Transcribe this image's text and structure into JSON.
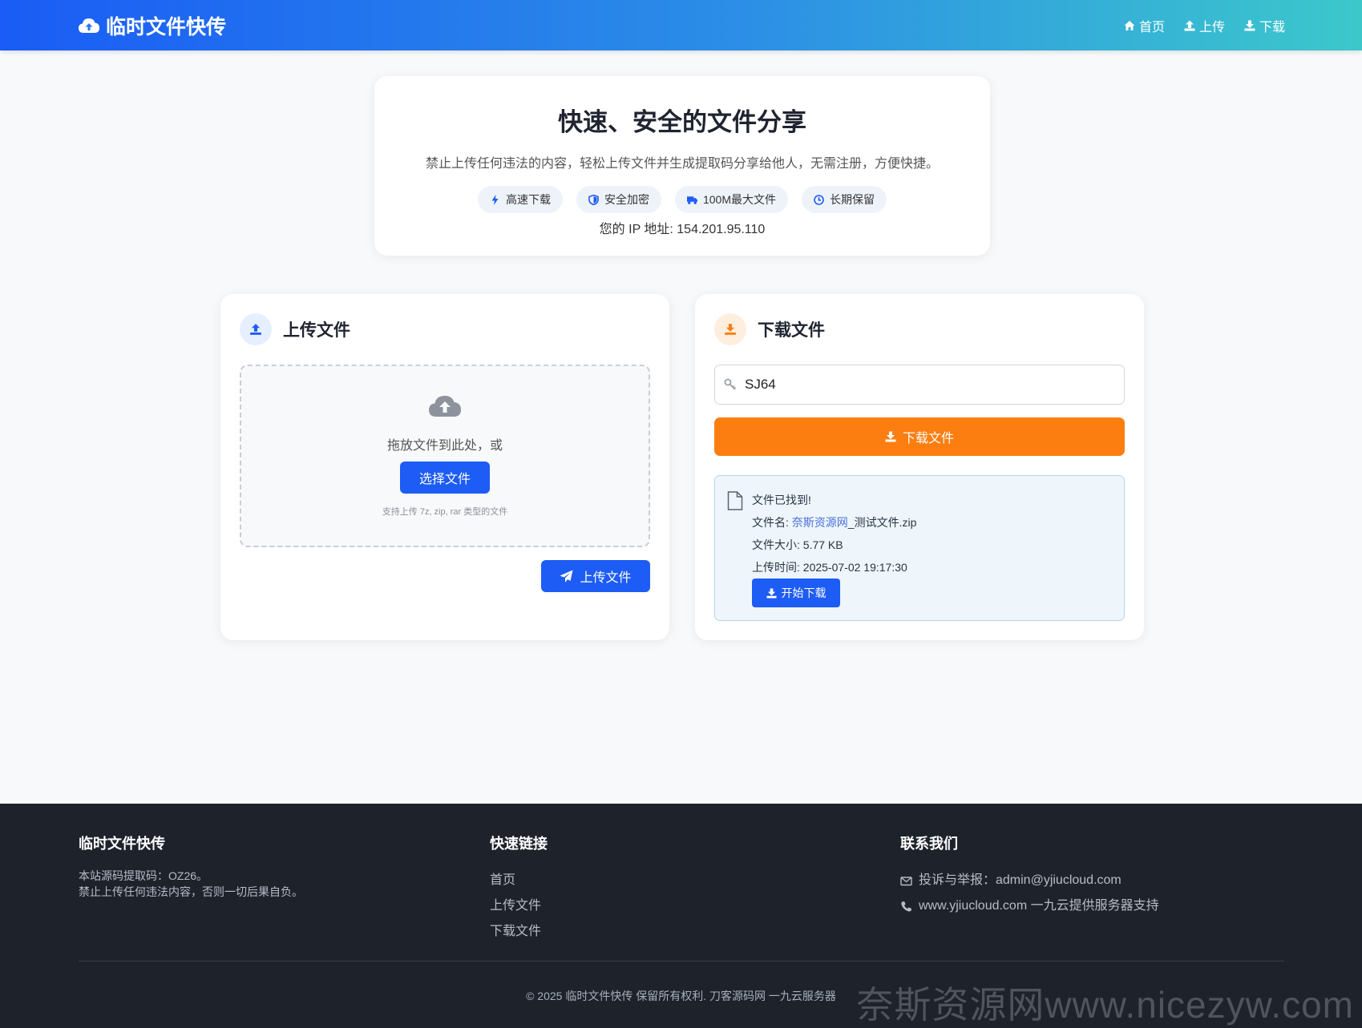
{
  "header": {
    "brand": "临时文件快传",
    "nav": [
      {
        "label": "首页",
        "icon": "home-icon"
      },
      {
        "label": "上传",
        "icon": "upload-icon"
      },
      {
        "label": "下载",
        "icon": "download-icon"
      }
    ]
  },
  "hero": {
    "title": "快速、安全的文件分享",
    "subtitle": "禁止上传任何违法的内容，轻松上传文件并生成提取码分享给他人，无需注册，方便快捷。",
    "features": [
      {
        "label": "高速下载",
        "icon": "bolt-icon"
      },
      {
        "label": "安全加密",
        "icon": "shield-icon"
      },
      {
        "label": "100M最大文件",
        "icon": "truck-icon"
      },
      {
        "label": "长期保留",
        "icon": "clock-icon"
      }
    ],
    "ip_line": "您的 IP 地址: 154.201.95.110"
  },
  "upload": {
    "title": "上传文件",
    "drop_text": "拖放文件到此处，或",
    "choose_label": "选择文件",
    "hint": "支持上传 7z, zip, rar 类型的文件",
    "submit_label": "上传文件"
  },
  "download": {
    "title": "下载文件",
    "code_value": "SJ64",
    "button_label": "下载文件",
    "result": {
      "found": "文件已找到!",
      "name_prefix": "文件名: ",
      "name_link": "奈斯资源网",
      "name_rest": "_测试文件.zip",
      "size": "文件大小: 5.77 KB",
      "time": "上传时间: 2025-07-02 19:17:30",
      "start_label": "开始下载"
    }
  },
  "footer": {
    "col1": {
      "title": "临时文件快传",
      "line1": "本站源码提取码：OZ26。",
      "line2": "禁止上传任何违法内容，否则一切后果自负。"
    },
    "col2": {
      "title": "快速链接",
      "links": [
        "首页",
        "上传文件",
        "下载文件"
      ]
    },
    "col3": {
      "title": "联系我们",
      "email": "投诉与举报：admin@yjiucloud.com",
      "site": "www.yjiucloud.com 一九云提供服务器支持"
    },
    "copyright": "© 2025 临时文件快传 保留所有权利. 刀客源码网  一九云服务器"
  },
  "watermark": "奈斯资源网www.nicezyw.com",
  "colors": {
    "primary": "#1d5cf5",
    "orange": "#fd7e10",
    "footer_bg": "#1d222b"
  }
}
